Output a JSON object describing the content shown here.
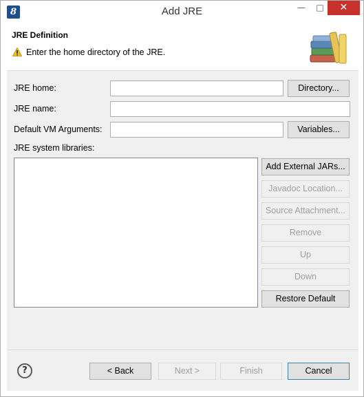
{
  "window": {
    "title": "Add JRE",
    "minimize_glyph": "—",
    "maximize_glyph": "□",
    "close_glyph": "✕"
  },
  "banner": {
    "title": "JRE Definition",
    "message": "Enter the home directory of the JRE.",
    "warning_icon": "warning-icon",
    "image_icon": "books-icon"
  },
  "form": {
    "jre_home_label": "JRE home:",
    "jre_home_value": "",
    "directory_button": "Directory...",
    "jre_name_label": "JRE name:",
    "jre_name_value": "",
    "vm_args_label": "Default VM Arguments:",
    "vm_args_value": "",
    "variables_button": "Variables...",
    "libraries_label": "JRE system libraries:"
  },
  "library_buttons": {
    "add_external_jars": "Add External JARs...",
    "javadoc_location": "Javadoc Location...",
    "source_attachment": "Source Attachment...",
    "remove": "Remove",
    "up": "Up",
    "down": "Down",
    "restore_default": "Restore Default"
  },
  "footer": {
    "help_glyph": "?",
    "back": "< Back",
    "next": "Next >",
    "finish": "Finish",
    "cancel": "Cancel"
  }
}
